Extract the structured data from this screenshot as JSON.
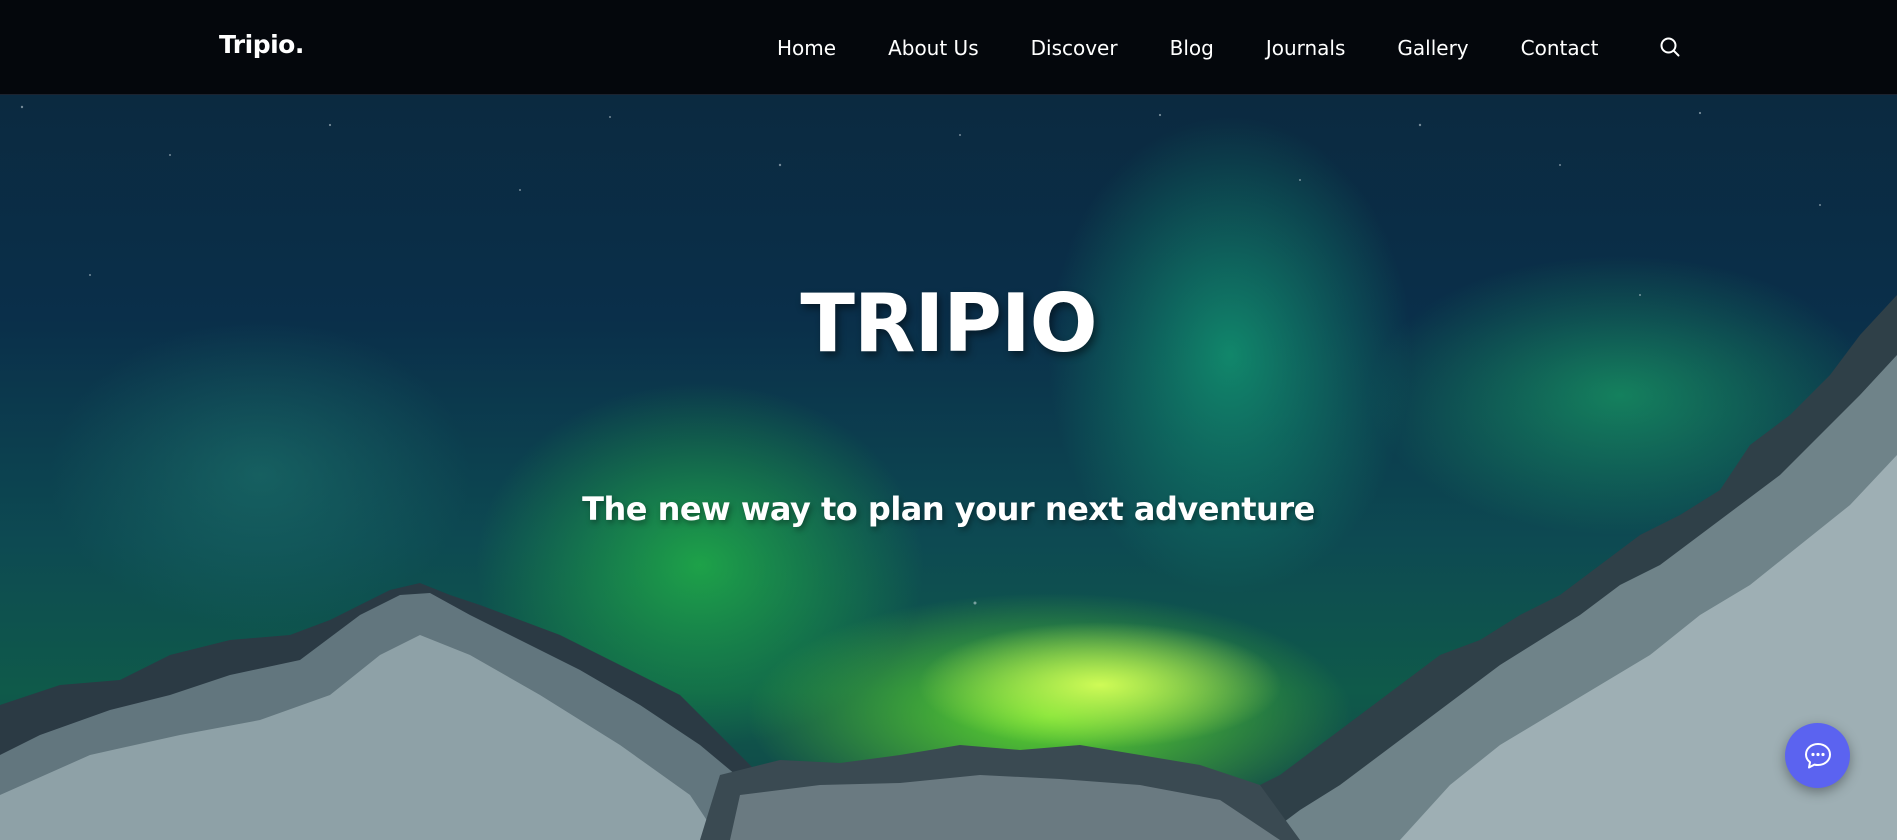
{
  "navbar": {
    "brand": "Tripio.",
    "links": [
      {
        "label": "Home"
      },
      {
        "label": "About Us"
      },
      {
        "label": "Discover"
      },
      {
        "label": "Blog"
      },
      {
        "label": "Journals"
      },
      {
        "label": "Gallery"
      },
      {
        "label": "Contact"
      }
    ],
    "search_icon": "search-icon"
  },
  "hero": {
    "title": "TRIPIO",
    "tagline": "The new way to plan your next adventure",
    "background": "aurora-over-snowy-mountains"
  },
  "chat": {
    "icon": "chat-bubble-icon",
    "color": "#5b63f0"
  }
}
